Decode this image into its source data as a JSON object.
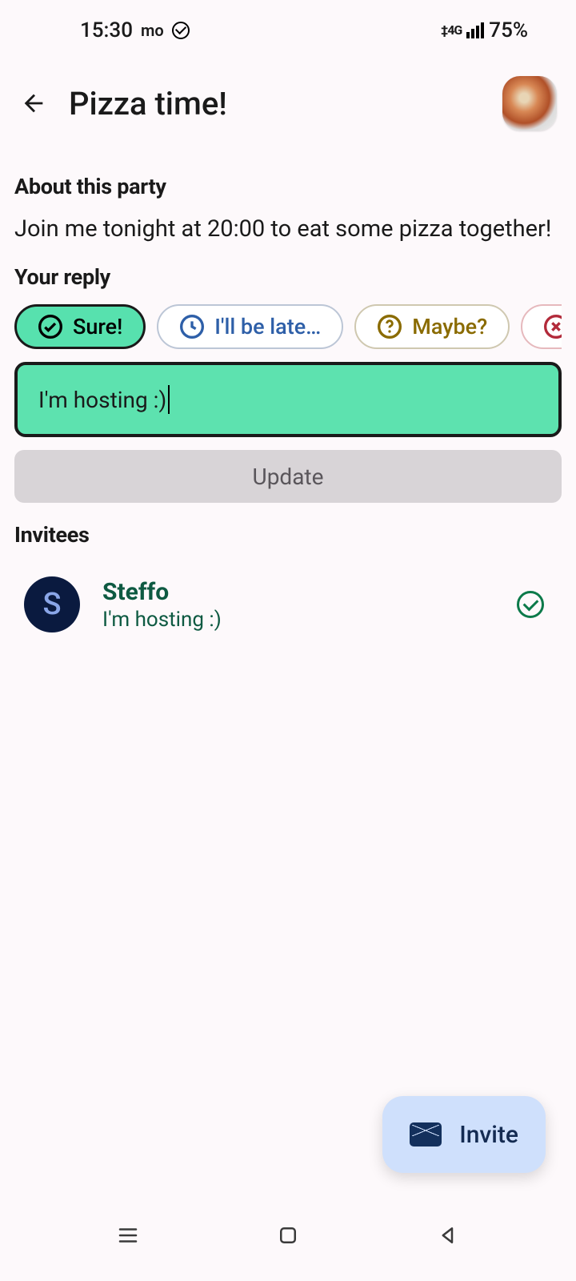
{
  "status": {
    "time": "15:30",
    "mo": "mo",
    "network": "4G",
    "battery": "75%"
  },
  "header": {
    "title": "Pizza time!"
  },
  "about": {
    "heading": "About this party",
    "text": "Join me tonight at 20:00 to eat some pizza together!"
  },
  "reply": {
    "heading": "Your reply",
    "chips": {
      "sure": "Sure!",
      "late": "I'll be late…",
      "maybe": "Maybe?",
      "no": "No"
    },
    "input_value": "I'm hosting :)",
    "update_label": "Update"
  },
  "invitees": {
    "heading": "Invitees",
    "list": [
      {
        "initial": "S",
        "name": "Steffo",
        "message": "I'm hosting :)"
      }
    ]
  },
  "fab": {
    "label": "Invite"
  }
}
